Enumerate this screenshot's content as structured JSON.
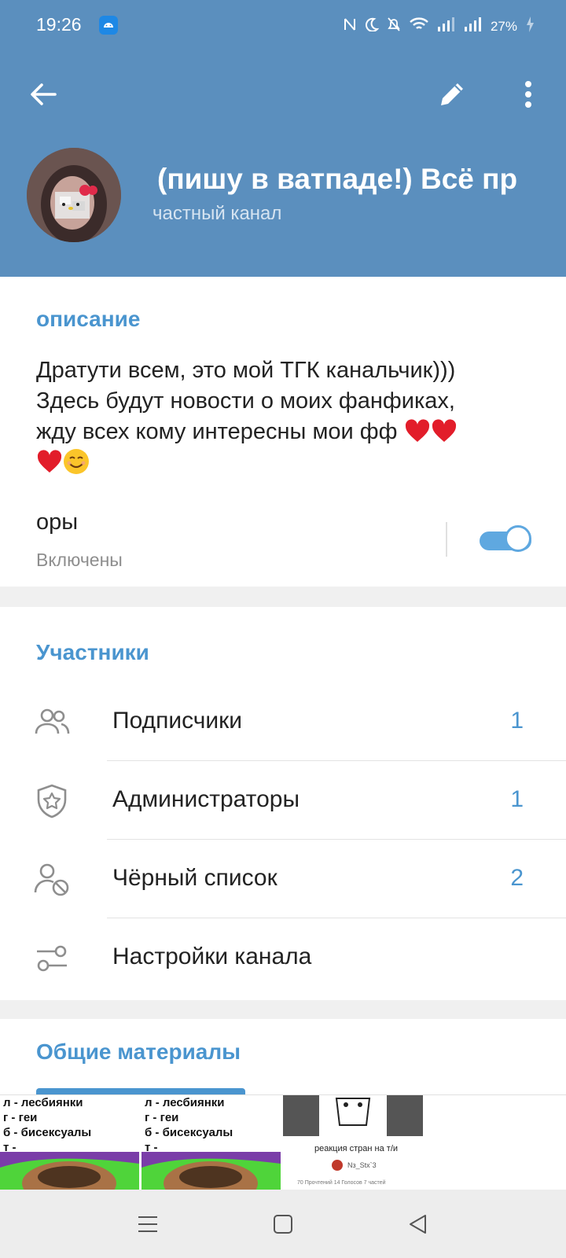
{
  "status_bar": {
    "time": "19:26",
    "battery": "27%",
    "icons": [
      "nfc-icon",
      "moon-icon",
      "bell-off-icon",
      "wifi-icon",
      "signal-icon",
      "signal-icon",
      "battery-icon"
    ]
  },
  "header": {
    "title": "(пишу в ватпаде!)   Всё пр",
    "subtitle": "частный канал",
    "background_color": "#5b8fbe"
  },
  "description": {
    "label": "описание",
    "text": "Дратути всем, это мой ТГК канальчик)))\nЗдесь будут новости о моих фанфиках,\nжду всех кому интересны мои фф"
  },
  "signatures": {
    "label": "оры",
    "status": "Включены",
    "enabled": true
  },
  "members": {
    "label": "Участники",
    "rows": [
      {
        "label": "Подписчики",
        "count": "1",
        "icon": "users-icon"
      },
      {
        "label": "Администраторы",
        "count": "1",
        "icon": "shield-star-icon"
      },
      {
        "label": "Чёрный список",
        "count": "2",
        "icon": "user-blocked-icon"
      },
      {
        "label": "Настройки канала",
        "count": "",
        "icon": "sliders-icon"
      }
    ]
  },
  "shared_media": {
    "label": "Общие материалы",
    "thumb_lines": [
      "л - лесбиянки",
      "г - геи",
      "б - бисексуалы",
      "т -"
    ],
    "poll_title": "реакция стран на т/и",
    "poll_author": "Nз_Stx`3",
    "poll_stats": "70 Прочтений   14 Голосов   7 частей",
    "accent_color": "#4a95cf"
  },
  "navbar": {
    "icons": [
      "menu-icon",
      "home-square-icon",
      "back-triangle-icon"
    ]
  }
}
